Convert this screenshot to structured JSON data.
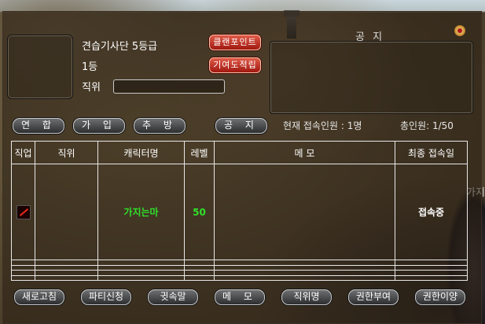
{
  "guild": {
    "name": "견습기사단 5등급",
    "rank": "1등",
    "position_label": "직위",
    "clan_points_button": "클랜포인트",
    "contribution_button": "기여도적립"
  },
  "notice": {
    "title": "공 지"
  },
  "tabs": {
    "alliance": "연 합",
    "join": "가 입",
    "expel": "추 방",
    "notice": "공 지"
  },
  "status": {
    "online": "현재 접속인원 : 1명",
    "total": "총인원: 1/50"
  },
  "table": {
    "headers": [
      "직업",
      "직위",
      "캐릭터명",
      "레벨",
      "메 모",
      "최종 접속일"
    ],
    "rows": [
      {
        "job_icon": "sword-icon",
        "position": "",
        "name": "가지는마",
        "level": "50",
        "memo": "",
        "last_login": "접속중"
      }
    ]
  },
  "bottom_buttons": {
    "refresh": "새로고침",
    "party": "파티신청",
    "whisper": "귓속말",
    "memo": "메 모",
    "position_name": "직위명",
    "grant": "권한부여",
    "transfer": "권한이양"
  },
  "background": {
    "side_text": "가지"
  },
  "colors": {
    "name_green": "#2fe02a",
    "button_red": "#c0301f"
  }
}
